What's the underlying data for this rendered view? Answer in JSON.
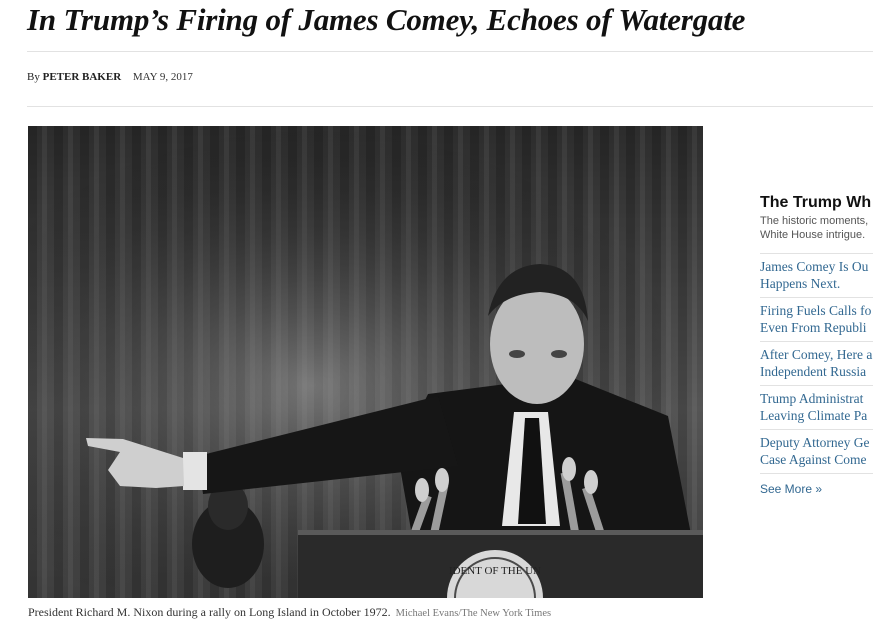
{
  "article": {
    "headline": "In Trump’s Firing of James Comey, Echoes of Watergate",
    "byline_prefix": "By",
    "author": "PETER BAKER",
    "date": "MAY 9, 2017"
  },
  "photo": {
    "caption": "President Richard M. Nixon during a rally on Long Island in October 1972.",
    "credit": "Michael Evans/The New York Times",
    "seal_text": "IDENT OF THE UN"
  },
  "sidebar": {
    "title": "The Trump Wh",
    "description": "The historic moments, White House intrigue.",
    "items": [
      {
        "label": "James Comey Is Ou\nHappens Next."
      },
      {
        "label": "Firing Fuels Calls fo\nEven From Republi"
      },
      {
        "label": "After Comey, Here a\nIndependent Russia"
      },
      {
        "label": "Trump Administrat\nLeaving Climate Pa"
      },
      {
        "label": "Deputy Attorney Ge\nCase Against Come"
      }
    ],
    "see_more": "See More »"
  },
  "colors": {
    "link": "#326891",
    "rule": "#e2e2e2",
    "text": "#111111"
  }
}
